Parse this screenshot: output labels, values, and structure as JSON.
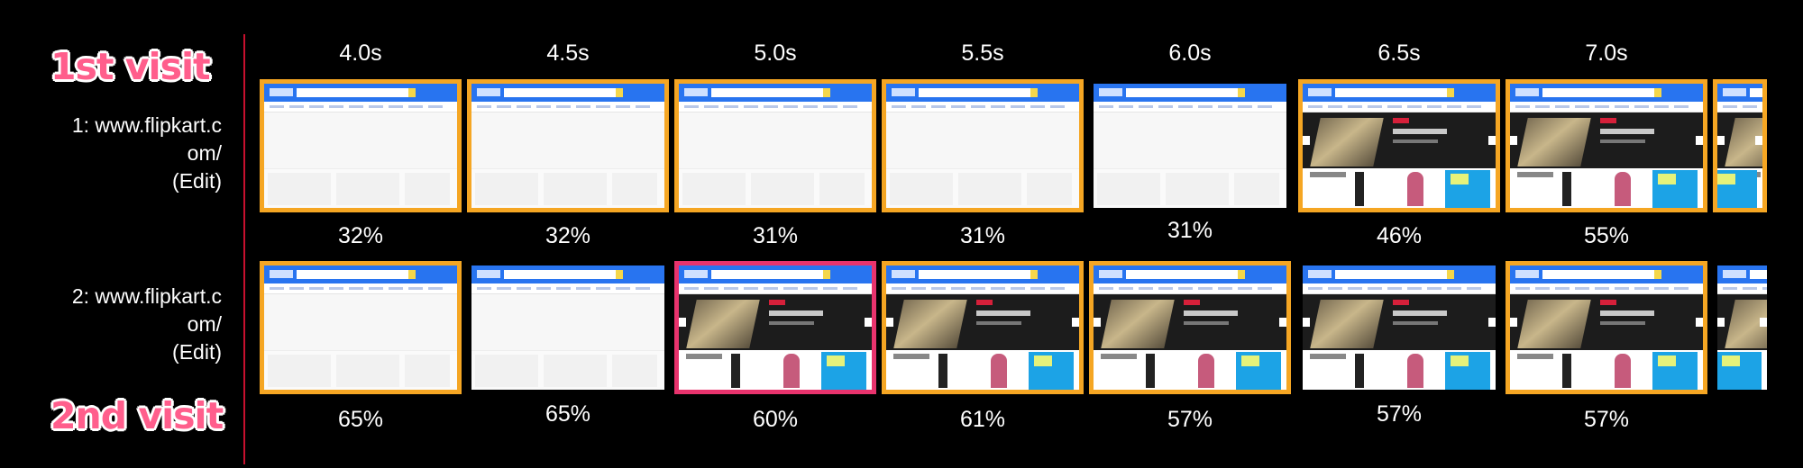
{
  "badges": {
    "first": "1st visit",
    "second": "2nd visit"
  },
  "rows": [
    {
      "label_lines": [
        "1: www.flipkart.c",
        "om/",
        "(Edit)"
      ],
      "frames": [
        {
          "time": "4.0s",
          "pct": "32%",
          "border": "orange",
          "content": "blank"
        },
        {
          "time": "4.5s",
          "pct": "32%",
          "border": "orange",
          "content": "blank"
        },
        {
          "time": "5.0s",
          "pct": "31%",
          "border": "orange",
          "content": "blank"
        },
        {
          "time": "5.5s",
          "pct": "31%",
          "border": "orange",
          "content": "blank"
        },
        {
          "time": "6.0s",
          "pct": "31%",
          "border": "none",
          "content": "blank"
        },
        {
          "time": "6.5s",
          "pct": "46%",
          "border": "orange",
          "content": "loaded"
        },
        {
          "time": "7.0s",
          "pct": "55%",
          "border": "orange",
          "content": "loaded"
        },
        {
          "time": "",
          "pct": "",
          "border": "orange",
          "content": "loaded"
        }
      ]
    },
    {
      "label_lines": [
        "2: www.flipkart.c",
        "om/",
        "(Edit)"
      ],
      "frames": [
        {
          "time": "",
          "pct": "65%",
          "border": "orange",
          "content": "blank"
        },
        {
          "time": "",
          "pct": "65%",
          "border": "none",
          "content": "blank"
        },
        {
          "time": "",
          "pct": "60%",
          "border": "pink",
          "content": "loaded"
        },
        {
          "time": "",
          "pct": "61%",
          "border": "orange",
          "content": "loaded"
        },
        {
          "time": "",
          "pct": "57%",
          "border": "orange",
          "content": "loaded"
        },
        {
          "time": "",
          "pct": "57%",
          "border": "none",
          "content": "loaded"
        },
        {
          "time": "",
          "pct": "57%",
          "border": "orange",
          "content": "loaded"
        },
        {
          "time": "",
          "pct": "",
          "border": "none",
          "content": "loaded"
        }
      ]
    }
  ],
  "colors": {
    "highlight_orange": "#f5a623",
    "highlight_pink": "#e8336d",
    "divider_red": "#c8102e",
    "badge_pink": "#ff5e8c"
  }
}
